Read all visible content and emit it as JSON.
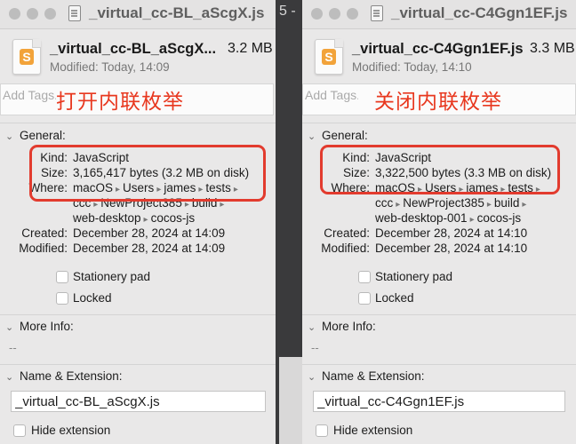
{
  "background_strip": {
    "text": "5 -"
  },
  "labels": {
    "general": "General:",
    "kind": "Kind:",
    "size": "Size:",
    "where": "Where:",
    "created": "Created:",
    "modified": "Modified:",
    "stationery": "Stationery pad",
    "locked": "Locked",
    "more_info": "More Info:",
    "more_info_value": "--",
    "name_ext": "Name & Extension:",
    "hide_ext": "Hide extension",
    "tags_placeholder": "Add Tags..."
  },
  "panels": [
    {
      "title": "_virtual_cc-BL_aScgX.js",
      "header_name": "_virtual_cc-BL_aScgX...",
      "header_size": "3.2 MB",
      "header_modified": "Modified: Today, 14:09",
      "annotation": "打开内联枚举",
      "kind": "JavaScript",
      "size_value": "3,165,417 bytes (3.2 MB on disk)",
      "where_line1": [
        "macOS",
        "Users",
        "james",
        "tests"
      ],
      "where_line2": [
        "ccc",
        "NewProject385",
        "build"
      ],
      "where_line3": [
        "web-desktop",
        "cocos-js"
      ],
      "created": "December 28, 2024 at 14:09",
      "modified": "December 28, 2024 at 14:09",
      "name_value": "_virtual_cc-BL_aScgX.js"
    },
    {
      "title": "_virtual_cc-C4Ggn1EF.js",
      "header_name": "_virtual_cc-C4Ggn1EF.js",
      "header_size": "3.3 MB",
      "header_modified": "Modified: Today, 14:10",
      "annotation": "关闭内联枚举",
      "kind": "JavaScript",
      "size_value": "3,322,500 bytes (3.3 MB on disk)",
      "where_line1": [
        "macOS",
        "Users",
        "james",
        "tests"
      ],
      "where_line2": [
        "ccc",
        "NewProject385",
        "build"
      ],
      "where_line3": [
        "web-desktop-001",
        "cocos-js"
      ],
      "created": "December 28, 2024 at 14:10",
      "modified": "December 28, 2024 at 14:10",
      "name_value": "_virtual_cc-C4Ggn1EF.js"
    }
  ],
  "colors": {
    "annotation": "#e8381f",
    "highlight_box": "#e23b2e",
    "app_icon": "#f2a33a"
  },
  "icons": {
    "app": "sublime-text-icon",
    "path_separator": "▸",
    "disclosure": "chevron-down-icon"
  }
}
